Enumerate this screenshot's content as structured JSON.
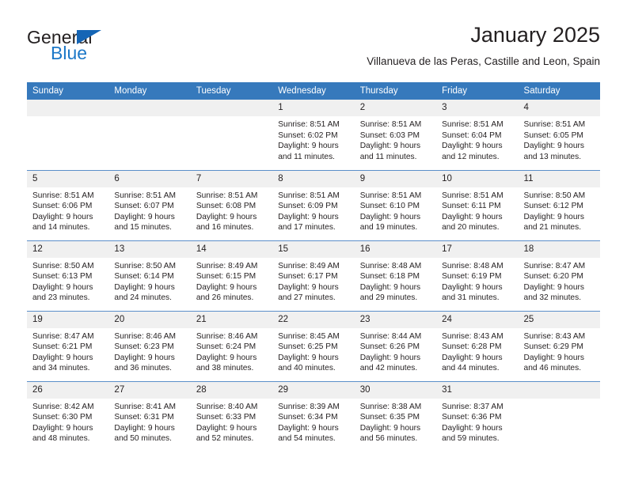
{
  "logo": {
    "word1": "General",
    "word2": "Blue",
    "triangle_color": "#1565b5",
    "word2_color": "#1c78c8"
  },
  "header": {
    "title": "January 2025",
    "subtitle": "Villanueva de las Peras, Castille and Leon, Spain"
  },
  "theme": {
    "header_bg": "#3679bc",
    "daynum_bg": "#f0f0f0",
    "row_divider": "#5b8fc9",
    "text": "#231f20"
  },
  "calendar": {
    "weekday_headers": [
      "Sunday",
      "Monday",
      "Tuesday",
      "Wednesday",
      "Thursday",
      "Friday",
      "Saturday"
    ],
    "labels": {
      "sunrise": "Sunrise:",
      "sunset": "Sunset:",
      "daylight": "Daylight:"
    },
    "weeks": [
      [
        {
          "day": "",
          "sunrise": "",
          "sunset": "",
          "daylight_line1": "",
          "daylight_line2": ""
        },
        {
          "day": "",
          "sunrise": "",
          "sunset": "",
          "daylight_line1": "",
          "daylight_line2": ""
        },
        {
          "day": "",
          "sunrise": "",
          "sunset": "",
          "daylight_line1": "",
          "daylight_line2": ""
        },
        {
          "day": "1",
          "sunrise": "Sunrise: 8:51 AM",
          "sunset": "Sunset: 6:02 PM",
          "daylight_line1": "Daylight: 9 hours",
          "daylight_line2": "and 11 minutes."
        },
        {
          "day": "2",
          "sunrise": "Sunrise: 8:51 AM",
          "sunset": "Sunset: 6:03 PM",
          "daylight_line1": "Daylight: 9 hours",
          "daylight_line2": "and 11 minutes."
        },
        {
          "day": "3",
          "sunrise": "Sunrise: 8:51 AM",
          "sunset": "Sunset: 6:04 PM",
          "daylight_line1": "Daylight: 9 hours",
          "daylight_line2": "and 12 minutes."
        },
        {
          "day": "4",
          "sunrise": "Sunrise: 8:51 AM",
          "sunset": "Sunset: 6:05 PM",
          "daylight_line1": "Daylight: 9 hours",
          "daylight_line2": "and 13 minutes."
        }
      ],
      [
        {
          "day": "5",
          "sunrise": "Sunrise: 8:51 AM",
          "sunset": "Sunset: 6:06 PM",
          "daylight_line1": "Daylight: 9 hours",
          "daylight_line2": "and 14 minutes."
        },
        {
          "day": "6",
          "sunrise": "Sunrise: 8:51 AM",
          "sunset": "Sunset: 6:07 PM",
          "daylight_line1": "Daylight: 9 hours",
          "daylight_line2": "and 15 minutes."
        },
        {
          "day": "7",
          "sunrise": "Sunrise: 8:51 AM",
          "sunset": "Sunset: 6:08 PM",
          "daylight_line1": "Daylight: 9 hours",
          "daylight_line2": "and 16 minutes."
        },
        {
          "day": "8",
          "sunrise": "Sunrise: 8:51 AM",
          "sunset": "Sunset: 6:09 PM",
          "daylight_line1": "Daylight: 9 hours",
          "daylight_line2": "and 17 minutes."
        },
        {
          "day": "9",
          "sunrise": "Sunrise: 8:51 AM",
          "sunset": "Sunset: 6:10 PM",
          "daylight_line1": "Daylight: 9 hours",
          "daylight_line2": "and 19 minutes."
        },
        {
          "day": "10",
          "sunrise": "Sunrise: 8:51 AM",
          "sunset": "Sunset: 6:11 PM",
          "daylight_line1": "Daylight: 9 hours",
          "daylight_line2": "and 20 minutes."
        },
        {
          "day": "11",
          "sunrise": "Sunrise: 8:50 AM",
          "sunset": "Sunset: 6:12 PM",
          "daylight_line1": "Daylight: 9 hours",
          "daylight_line2": "and 21 minutes."
        }
      ],
      [
        {
          "day": "12",
          "sunrise": "Sunrise: 8:50 AM",
          "sunset": "Sunset: 6:13 PM",
          "daylight_line1": "Daylight: 9 hours",
          "daylight_line2": "and 23 minutes."
        },
        {
          "day": "13",
          "sunrise": "Sunrise: 8:50 AM",
          "sunset": "Sunset: 6:14 PM",
          "daylight_line1": "Daylight: 9 hours",
          "daylight_line2": "and 24 minutes."
        },
        {
          "day": "14",
          "sunrise": "Sunrise: 8:49 AM",
          "sunset": "Sunset: 6:15 PM",
          "daylight_line1": "Daylight: 9 hours",
          "daylight_line2": "and 26 minutes."
        },
        {
          "day": "15",
          "sunrise": "Sunrise: 8:49 AM",
          "sunset": "Sunset: 6:17 PM",
          "daylight_line1": "Daylight: 9 hours",
          "daylight_line2": "and 27 minutes."
        },
        {
          "day": "16",
          "sunrise": "Sunrise: 8:48 AM",
          "sunset": "Sunset: 6:18 PM",
          "daylight_line1": "Daylight: 9 hours",
          "daylight_line2": "and 29 minutes."
        },
        {
          "day": "17",
          "sunrise": "Sunrise: 8:48 AM",
          "sunset": "Sunset: 6:19 PM",
          "daylight_line1": "Daylight: 9 hours",
          "daylight_line2": "and 31 minutes."
        },
        {
          "day": "18",
          "sunrise": "Sunrise: 8:47 AM",
          "sunset": "Sunset: 6:20 PM",
          "daylight_line1": "Daylight: 9 hours",
          "daylight_line2": "and 32 minutes."
        }
      ],
      [
        {
          "day": "19",
          "sunrise": "Sunrise: 8:47 AM",
          "sunset": "Sunset: 6:21 PM",
          "daylight_line1": "Daylight: 9 hours",
          "daylight_line2": "and 34 minutes."
        },
        {
          "day": "20",
          "sunrise": "Sunrise: 8:46 AM",
          "sunset": "Sunset: 6:23 PM",
          "daylight_line1": "Daylight: 9 hours",
          "daylight_line2": "and 36 minutes."
        },
        {
          "day": "21",
          "sunrise": "Sunrise: 8:46 AM",
          "sunset": "Sunset: 6:24 PM",
          "daylight_line1": "Daylight: 9 hours",
          "daylight_line2": "and 38 minutes."
        },
        {
          "day": "22",
          "sunrise": "Sunrise: 8:45 AM",
          "sunset": "Sunset: 6:25 PM",
          "daylight_line1": "Daylight: 9 hours",
          "daylight_line2": "and 40 minutes."
        },
        {
          "day": "23",
          "sunrise": "Sunrise: 8:44 AM",
          "sunset": "Sunset: 6:26 PM",
          "daylight_line1": "Daylight: 9 hours",
          "daylight_line2": "and 42 minutes."
        },
        {
          "day": "24",
          "sunrise": "Sunrise: 8:43 AM",
          "sunset": "Sunset: 6:28 PM",
          "daylight_line1": "Daylight: 9 hours",
          "daylight_line2": "and 44 minutes."
        },
        {
          "day": "25",
          "sunrise": "Sunrise: 8:43 AM",
          "sunset": "Sunset: 6:29 PM",
          "daylight_line1": "Daylight: 9 hours",
          "daylight_line2": "and 46 minutes."
        }
      ],
      [
        {
          "day": "26",
          "sunrise": "Sunrise: 8:42 AM",
          "sunset": "Sunset: 6:30 PM",
          "daylight_line1": "Daylight: 9 hours",
          "daylight_line2": "and 48 minutes."
        },
        {
          "day": "27",
          "sunrise": "Sunrise: 8:41 AM",
          "sunset": "Sunset: 6:31 PM",
          "daylight_line1": "Daylight: 9 hours",
          "daylight_line2": "and 50 minutes."
        },
        {
          "day": "28",
          "sunrise": "Sunrise: 8:40 AM",
          "sunset": "Sunset: 6:33 PM",
          "daylight_line1": "Daylight: 9 hours",
          "daylight_line2": "and 52 minutes."
        },
        {
          "day": "29",
          "sunrise": "Sunrise: 8:39 AM",
          "sunset": "Sunset: 6:34 PM",
          "daylight_line1": "Daylight: 9 hours",
          "daylight_line2": "and 54 minutes."
        },
        {
          "day": "30",
          "sunrise": "Sunrise: 8:38 AM",
          "sunset": "Sunset: 6:35 PM",
          "daylight_line1": "Daylight: 9 hours",
          "daylight_line2": "and 56 minutes."
        },
        {
          "day": "31",
          "sunrise": "Sunrise: 8:37 AM",
          "sunset": "Sunset: 6:36 PM",
          "daylight_line1": "Daylight: 9 hours",
          "daylight_line2": "and 59 minutes."
        },
        {
          "day": "",
          "sunrise": "",
          "sunset": "",
          "daylight_line1": "",
          "daylight_line2": ""
        }
      ]
    ]
  }
}
